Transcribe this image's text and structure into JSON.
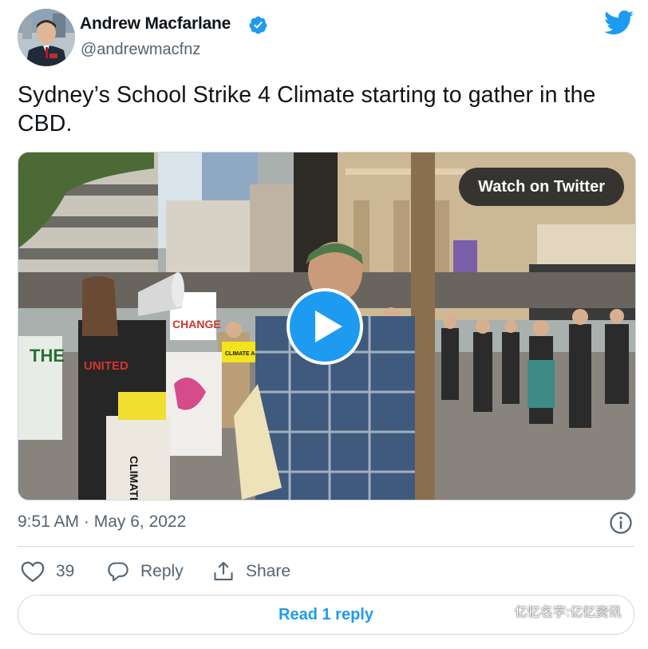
{
  "author": {
    "name": "Andrew Macfarlane",
    "handle": "@andrewmacfnz",
    "verified": true
  },
  "tweet": {
    "text": "Sydney’s School Strike 4 Climate starting to gather in the CBD."
  },
  "media": {
    "type": "video",
    "watch_label": "Watch on Twitter",
    "scene_signs": {
      "sign_left": "THE",
      "sign_change": "CHANGE",
      "sign_center": "CLIMATE ACTION NOW",
      "shirt_text": "UNITED",
      "bag_text": "CLIMATE"
    }
  },
  "meta": {
    "timestamp": "9:51 AM · May 6, 2022"
  },
  "actions": {
    "like_count": "39",
    "reply_label": "Reply",
    "share_label": "Share"
  },
  "read_replies_label": "Read 1 reply",
  "watermark": "亿忆名字:亿忆资讯",
  "colors": {
    "brand": "#1d9bf0",
    "text_primary": "#0f1419",
    "text_secondary": "#536471",
    "border": "#cfd9de"
  },
  "icons": [
    "twitter-bird-icon",
    "verified-badge-icon",
    "play-icon",
    "info-icon",
    "heart-icon",
    "reply-icon",
    "share-icon"
  ]
}
